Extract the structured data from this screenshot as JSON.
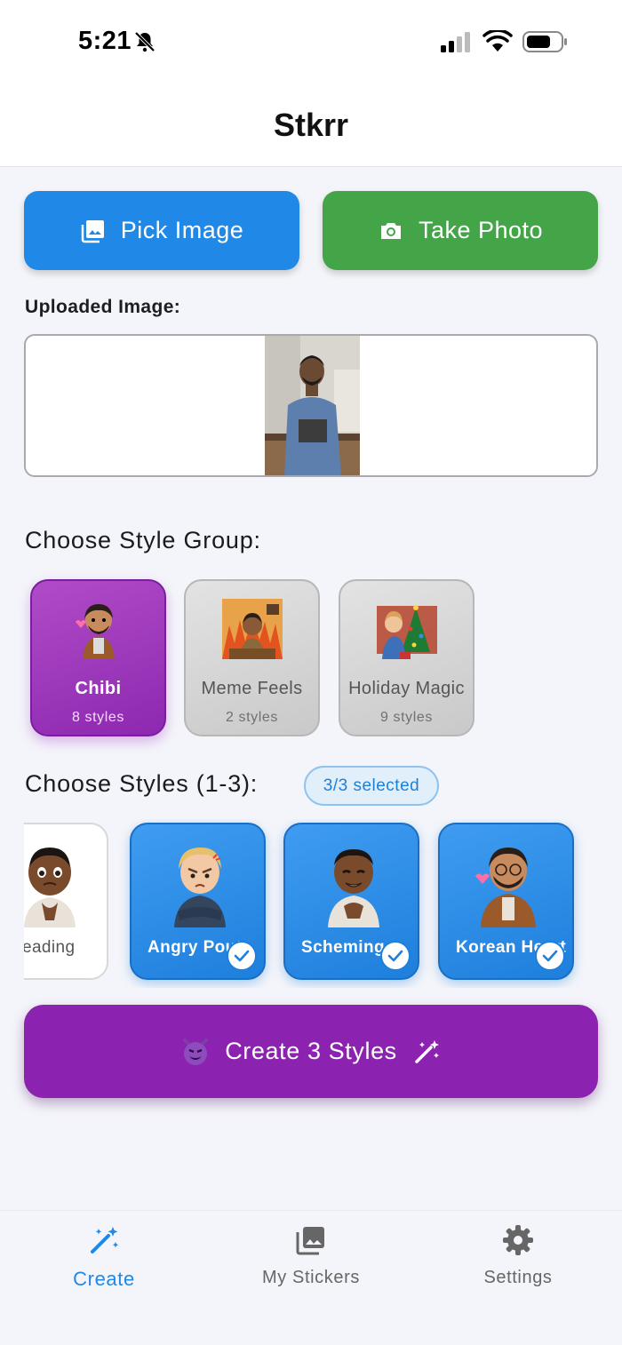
{
  "status": {
    "time": "5:21"
  },
  "header": {
    "title": "Stkrr"
  },
  "actions": {
    "pick_label": "Pick Image",
    "take_label": "Take Photo"
  },
  "upload": {
    "label": "Uploaded Image:"
  },
  "groups": {
    "heading": "Choose Style Group:",
    "items": [
      {
        "name": "Chibi",
        "count": "8 styles",
        "selected": true
      },
      {
        "name": "Meme Feels",
        "count": "2 styles",
        "selected": false
      },
      {
        "name": "Holiday Magic",
        "count": "9 styles",
        "selected": false
      }
    ]
  },
  "styles": {
    "heading": "Choose Styles (1-3):",
    "badge": "3/3 selected",
    "items": [
      {
        "name": "eading",
        "selected": false
      },
      {
        "name": "Angry Pout",
        "selected": true
      },
      {
        "name": "Scheming",
        "selected": true
      },
      {
        "name": "Korean Heart",
        "selected": true
      }
    ]
  },
  "create": {
    "label": "Create 3 Styles"
  },
  "nav": {
    "items": [
      {
        "label": "Create",
        "active": true
      },
      {
        "label": "My Stickers",
        "active": false
      },
      {
        "label": "Settings",
        "active": false
      }
    ]
  },
  "colors": {
    "blue": "#2088e6",
    "green": "#43a548",
    "purple": "#8b22b0"
  }
}
